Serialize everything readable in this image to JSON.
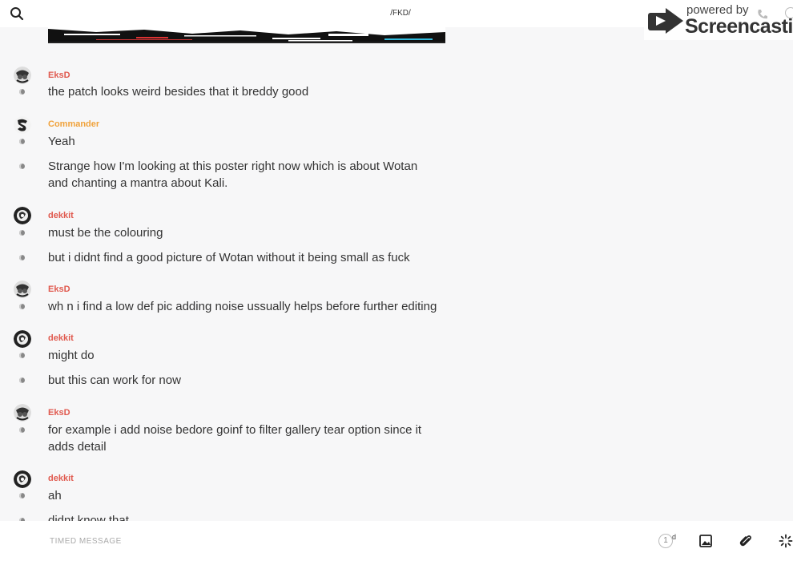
{
  "header": {
    "channel": "/FKD/"
  },
  "watermark": {
    "line1": "powered by",
    "line2": "Screencastify"
  },
  "messages": [
    {
      "author": "EksD",
      "author_color": "#e05a4f",
      "lines": [
        "the patch looks weird besides that it breddy good"
      ]
    },
    {
      "author": "Commander",
      "author_color": "#f0a23b",
      "lines": [
        "Yeah",
        "Strange how I'm looking at this poster right now which is about Wotan and chanting a mantra about Kali."
      ]
    },
    {
      "author": "dekkit",
      "author_color": "#e05a4f",
      "lines": [
        "must be the colouring",
        "but i didnt find a good picture of Wotan without it being small as fuck"
      ]
    },
    {
      "author": "EksD",
      "author_color": "#e05a4f",
      "lines": [
        "wh n i find a low def pic adding noise ussually helps before further editing"
      ]
    },
    {
      "author": "dekkit",
      "author_color": "#e05a4f",
      "lines": [
        "might do",
        "but this can work for now"
      ]
    },
    {
      "author": "EksD",
      "author_color": "#e05a4f",
      "lines": [
        "for example i add noise bedore goinf to filter gallery tear option since it adds detail"
      ]
    },
    {
      "author": "dekkit",
      "author_color": "#e05a4f",
      "lines": [
        "ah",
        "didnt know that"
      ]
    }
  ],
  "composer": {
    "placeholder": "TIMED MESSAGE",
    "timer_value": "1",
    "timer_unit": "d"
  },
  "icons": [
    "search-icon",
    "phone-icon",
    "info-icon",
    "image-icon",
    "paperclip-icon",
    "sparkle-icon"
  ]
}
